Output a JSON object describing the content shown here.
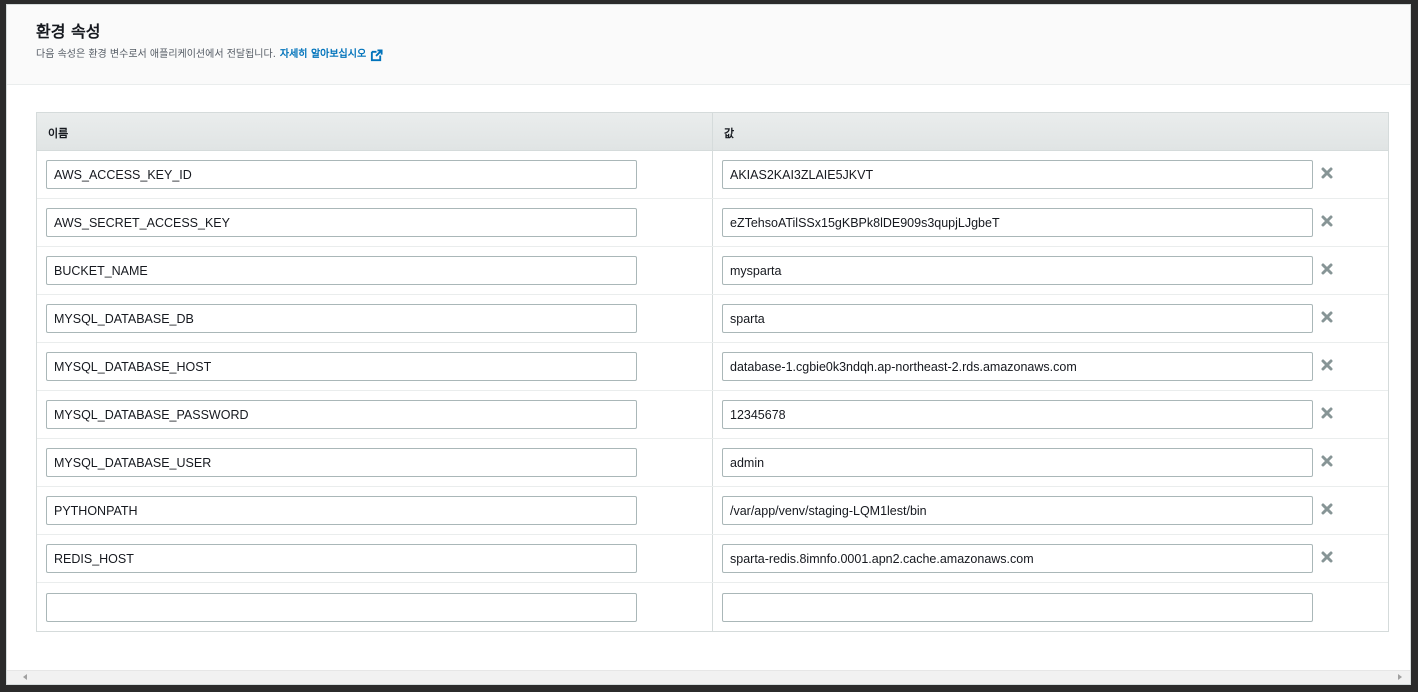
{
  "header": {
    "title": "환경 속성",
    "description": "다음 속성은 환경 변수로서 애플리케이션에서 전달됩니다.",
    "learn_more": "자세히 알아보십시오",
    "learn_more_icon": "external-link-icon"
  },
  "table": {
    "columns": {
      "name": "이름",
      "value": "값"
    },
    "rows": [
      {
        "name": "AWS_ACCESS_KEY_ID",
        "value": "AKIAS2KAI3ZLAIE5JKVT"
      },
      {
        "name": "AWS_SECRET_ACCESS_KEY",
        "value": "eZTehsoATilSSx15gKBPk8lDE909s3qupjLJgbeT"
      },
      {
        "name": "BUCKET_NAME",
        "value": "mysparta"
      },
      {
        "name": "MYSQL_DATABASE_DB",
        "value": "sparta"
      },
      {
        "name": "MYSQL_DATABASE_HOST",
        "value": "database-1.cgbie0k3ndqh.ap-northeast-2.rds.amazonaws.com"
      },
      {
        "name": "MYSQL_DATABASE_PASSWORD",
        "value": "12345678"
      },
      {
        "name": "MYSQL_DATABASE_USER",
        "value": "admin"
      },
      {
        "name": "PYTHONPATH",
        "value": "/var/app/venv/staging-LQM1lest/bin"
      },
      {
        "name": "REDIS_HOST",
        "value": "sparta-redis.8imnfo.0001.apn2.cache.amazonaws.com"
      },
      {
        "name": "",
        "value": ""
      }
    ]
  },
  "colors": {
    "accent": "#0073bb",
    "remove_icon": "#879596"
  }
}
